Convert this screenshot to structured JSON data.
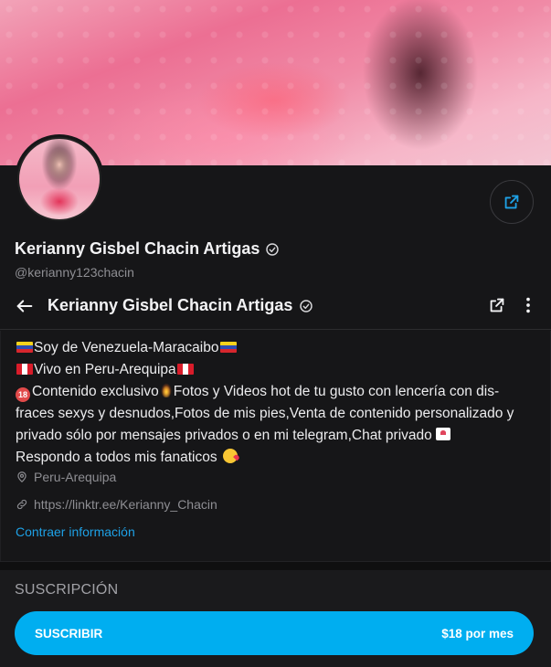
{
  "profile": {
    "display_name": "Kerianny Gisbel Chacin Artigas",
    "handle": "@kerianny123chacin"
  },
  "topbar": {
    "title": "Kerianny Gisbel Chacin Artigas"
  },
  "bio": {
    "line1": "Soy de Venezuela-Maracaibo",
    "line2": "Vivo en Peru-Arequipa",
    "line3a": "Contenido exclusivo",
    "line3b": "Fotos y Videos hot de tu gusto con lencería con dis-",
    "line4": "fraces sexys y desnudos,Fotos de mis pies,Venta de contenido personalizado y",
    "line5": "privado sólo por mensajes privados o en mi telegram,Chat privado",
    "line6": "Respondo a todos mis fanaticos",
    "badge_18": "18"
  },
  "meta": {
    "location": "Peru-Arequipa",
    "link": "https://linktr.ee/Kerianny_Chacin"
  },
  "actions": {
    "collapse_label": "Contraer información"
  },
  "subscription": {
    "section_title": "SUSCRIPCIÓN",
    "button_label": "SUSCRIBIR",
    "price": "$18 por mes"
  },
  "icons": {
    "verified": "verified-check-icon",
    "share": "share-icon",
    "back": "arrow-left-icon",
    "more": "more-vertical-icon",
    "location": "map-pin-icon",
    "link": "link-icon"
  },
  "colors": {
    "accent": "#00aef0",
    "link": "#1ea1e6",
    "background": "#161618"
  }
}
